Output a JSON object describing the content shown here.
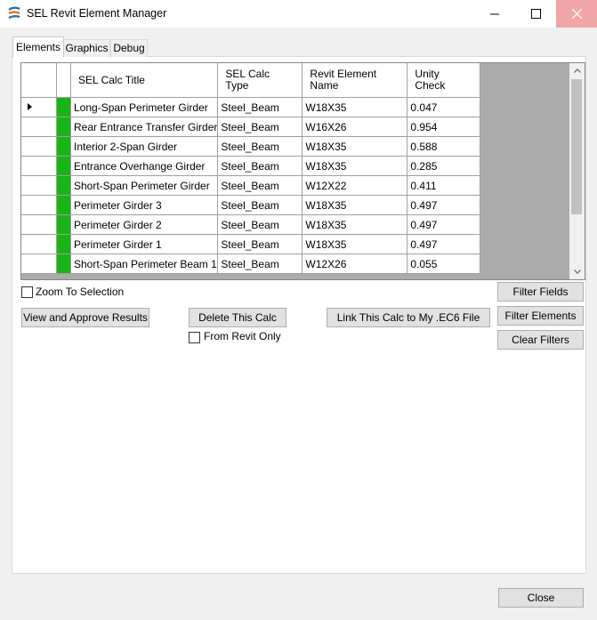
{
  "window": {
    "title": "SEL Revit Element Manager",
    "controls": {
      "minimize": "—",
      "maximize": "☐",
      "close": "✕"
    }
  },
  "tabs": [
    {
      "label": "Elements",
      "active": true
    },
    {
      "label": "Graphics",
      "active": false
    },
    {
      "label": "Debug",
      "active": false
    }
  ],
  "grid": {
    "columns": {
      "title_line1": "SEL Calc Title",
      "type_line1": "SEL Calc",
      "type_line2": "Type",
      "name_line1": "Revit Element",
      "name_line2": "Name",
      "unity_line1": "Unity",
      "unity_line2": "Check"
    },
    "row_status_color": "#18b418",
    "rows": [
      {
        "title": "Long-Span Perimeter Girder",
        "type": "Steel_Beam",
        "name": "W18X35",
        "unity": "0.047"
      },
      {
        "title": "Rear Entrance Transfer Girder",
        "type": "Steel_Beam",
        "name": "W16X26",
        "unity": "0.954"
      },
      {
        "title": "Interior 2-Span Girder",
        "type": "Steel_Beam",
        "name": "W18X35",
        "unity": "0.588"
      },
      {
        "title": "Entrance Overhange Girder",
        "type": "Steel_Beam",
        "name": "W18X35",
        "unity": "0.285"
      },
      {
        "title": "Short-Span Perimeter Girder",
        "type": "Steel_Beam",
        "name": "W12X22",
        "unity": "0.411"
      },
      {
        "title": "Perimeter Girder 3",
        "type": "Steel_Beam",
        "name": "W18X35",
        "unity": "0.497"
      },
      {
        "title": "Perimeter Girder 2",
        "type": "Steel_Beam",
        "name": "W18X35",
        "unity": "0.497"
      },
      {
        "title": "Perimeter Girder 1",
        "type": "Steel_Beam",
        "name": "W18X35",
        "unity": "0.497"
      },
      {
        "title": "Short-Span Perimeter Beam 1",
        "type": "Steel_Beam",
        "name": "W12X26",
        "unity": "0.055"
      }
    ]
  },
  "controls": {
    "zoom_to_selection": "Zoom To Selection",
    "from_revit_only": "From Revit Only",
    "view_approve": "View and Approve Results",
    "delete_calc": "Delete This Calc",
    "link_calc": "Link This Calc to My .EC6 File",
    "filter_fields": "Filter Fields",
    "filter_elements": "Filter Elements",
    "clear_filters": "Clear Filters",
    "close": "Close"
  }
}
